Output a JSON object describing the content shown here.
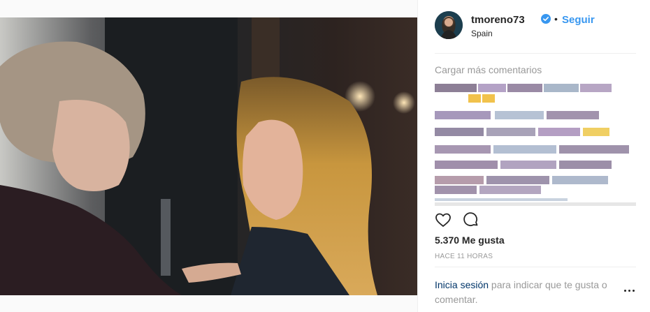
{
  "post": {
    "username": "tmoreno73",
    "verified_icon": "verified-badge-icon",
    "separator": "•",
    "follow_label": "Seguir",
    "location": "Spain",
    "load_more_label": "Cargar más comentarios",
    "likes_label": "5.370 Me gusta",
    "time_label": "HACE 11 HORAS",
    "login_link": "Inicia sesión",
    "login_text": " para indicar que te gusta o comentar."
  },
  "icons": {
    "like": "heart-icon",
    "comment": "comment-icon",
    "more": "more-options-icon"
  },
  "colors": {
    "link_blue": "#3897f0",
    "login_blue": "#003569",
    "muted_gray": "#999999",
    "text": "#262626"
  }
}
